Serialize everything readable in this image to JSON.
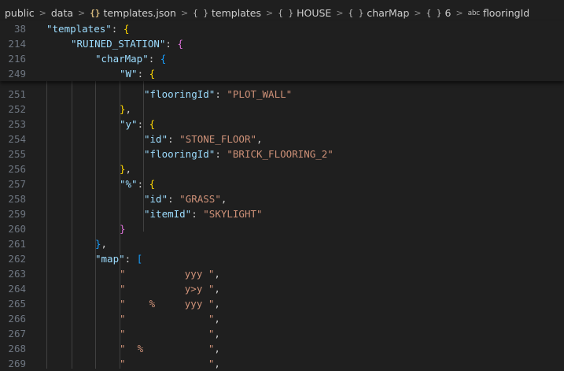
{
  "breadcrumb": {
    "items": [
      {
        "label": "public",
        "icon": ""
      },
      {
        "label": "data",
        "icon": ""
      },
      {
        "label": "templates.json",
        "icon": "json-file-icon"
      },
      {
        "label": "templates",
        "icon": "object-icon"
      },
      {
        "label": "HOUSE",
        "icon": "object-icon"
      },
      {
        "label": "charMap",
        "icon": "object-icon"
      },
      {
        "label": "6",
        "icon": "object-icon"
      },
      {
        "label": "flooringId",
        "icon": "string-icon"
      }
    ],
    "icon_glyphs": {
      "json": "{}",
      "object": "{ }",
      "string": "abc"
    },
    "separator": ">"
  },
  "sticky": [
    {
      "num": "38",
      "indent": 1,
      "key": "templates",
      "after": ": ",
      "open": "{",
      "open_class": "b1"
    },
    {
      "num": "214",
      "indent": 2,
      "key": "RUINED_STATION",
      "after": ": ",
      "open": "{",
      "open_class": "b2"
    },
    {
      "num": "216",
      "indent": 3,
      "key": "charMap",
      "after": ": ",
      "open": "{",
      "open_class": "b3"
    },
    {
      "num": "249",
      "indent": 4,
      "key": "W",
      "after": ": ",
      "open": "{",
      "open_class": "b1"
    }
  ],
  "lines": [
    {
      "num": "251",
      "indent": 5,
      "key": "flooringId",
      "value": "PLOT_WALL"
    },
    {
      "num": "252",
      "indent": 4,
      "close": "}",
      "close_class": "b1",
      "tail": ","
    },
    {
      "num": "253",
      "indent": 4,
      "key": "y",
      "open": "{",
      "open_class": "b1"
    },
    {
      "num": "254",
      "indent": 5,
      "key": "id",
      "value": "STONE_FLOOR",
      "tail": ","
    },
    {
      "num": "255",
      "indent": 5,
      "key": "flooringId",
      "value": "BRICK_FLOORING_2"
    },
    {
      "num": "256",
      "indent": 4,
      "close": "}",
      "close_class": "b1",
      "tail": ","
    },
    {
      "num": "257",
      "indent": 4,
      "key": "%",
      "open": "{",
      "open_class": "b1"
    },
    {
      "num": "258",
      "indent": 5,
      "key": "id",
      "value": "GRASS",
      "tail": ","
    },
    {
      "num": "259",
      "indent": 5,
      "key": "itemId",
      "value": "SKYLIGHT"
    },
    {
      "num": "260",
      "indent": 4,
      "close": "}",
      "close_class": "b2"
    },
    {
      "num": "261",
      "indent": 3,
      "close": "}",
      "close_class": "b3",
      "tail": ","
    },
    {
      "num": "262",
      "indent": 3,
      "key": "map",
      "open": "[",
      "open_class": "b3"
    },
    {
      "num": "263",
      "indent": 4,
      "str": "          yyy ",
      "tail": ","
    },
    {
      "num": "264",
      "indent": 4,
      "str": "          y>y ",
      "tail": ","
    },
    {
      "num": "265",
      "indent": 4,
      "str": "    %     yyy ",
      "tail": ","
    },
    {
      "num": "266",
      "indent": 4,
      "str": "              ",
      "tail": ","
    },
    {
      "num": "267",
      "indent": 4,
      "str": "              ",
      "tail": ","
    },
    {
      "num": "268",
      "indent": 4,
      "str": "  %           ",
      "tail": ","
    },
    {
      "num": "269",
      "indent": 4,
      "str": "              ",
      "tail": ","
    }
  ]
}
